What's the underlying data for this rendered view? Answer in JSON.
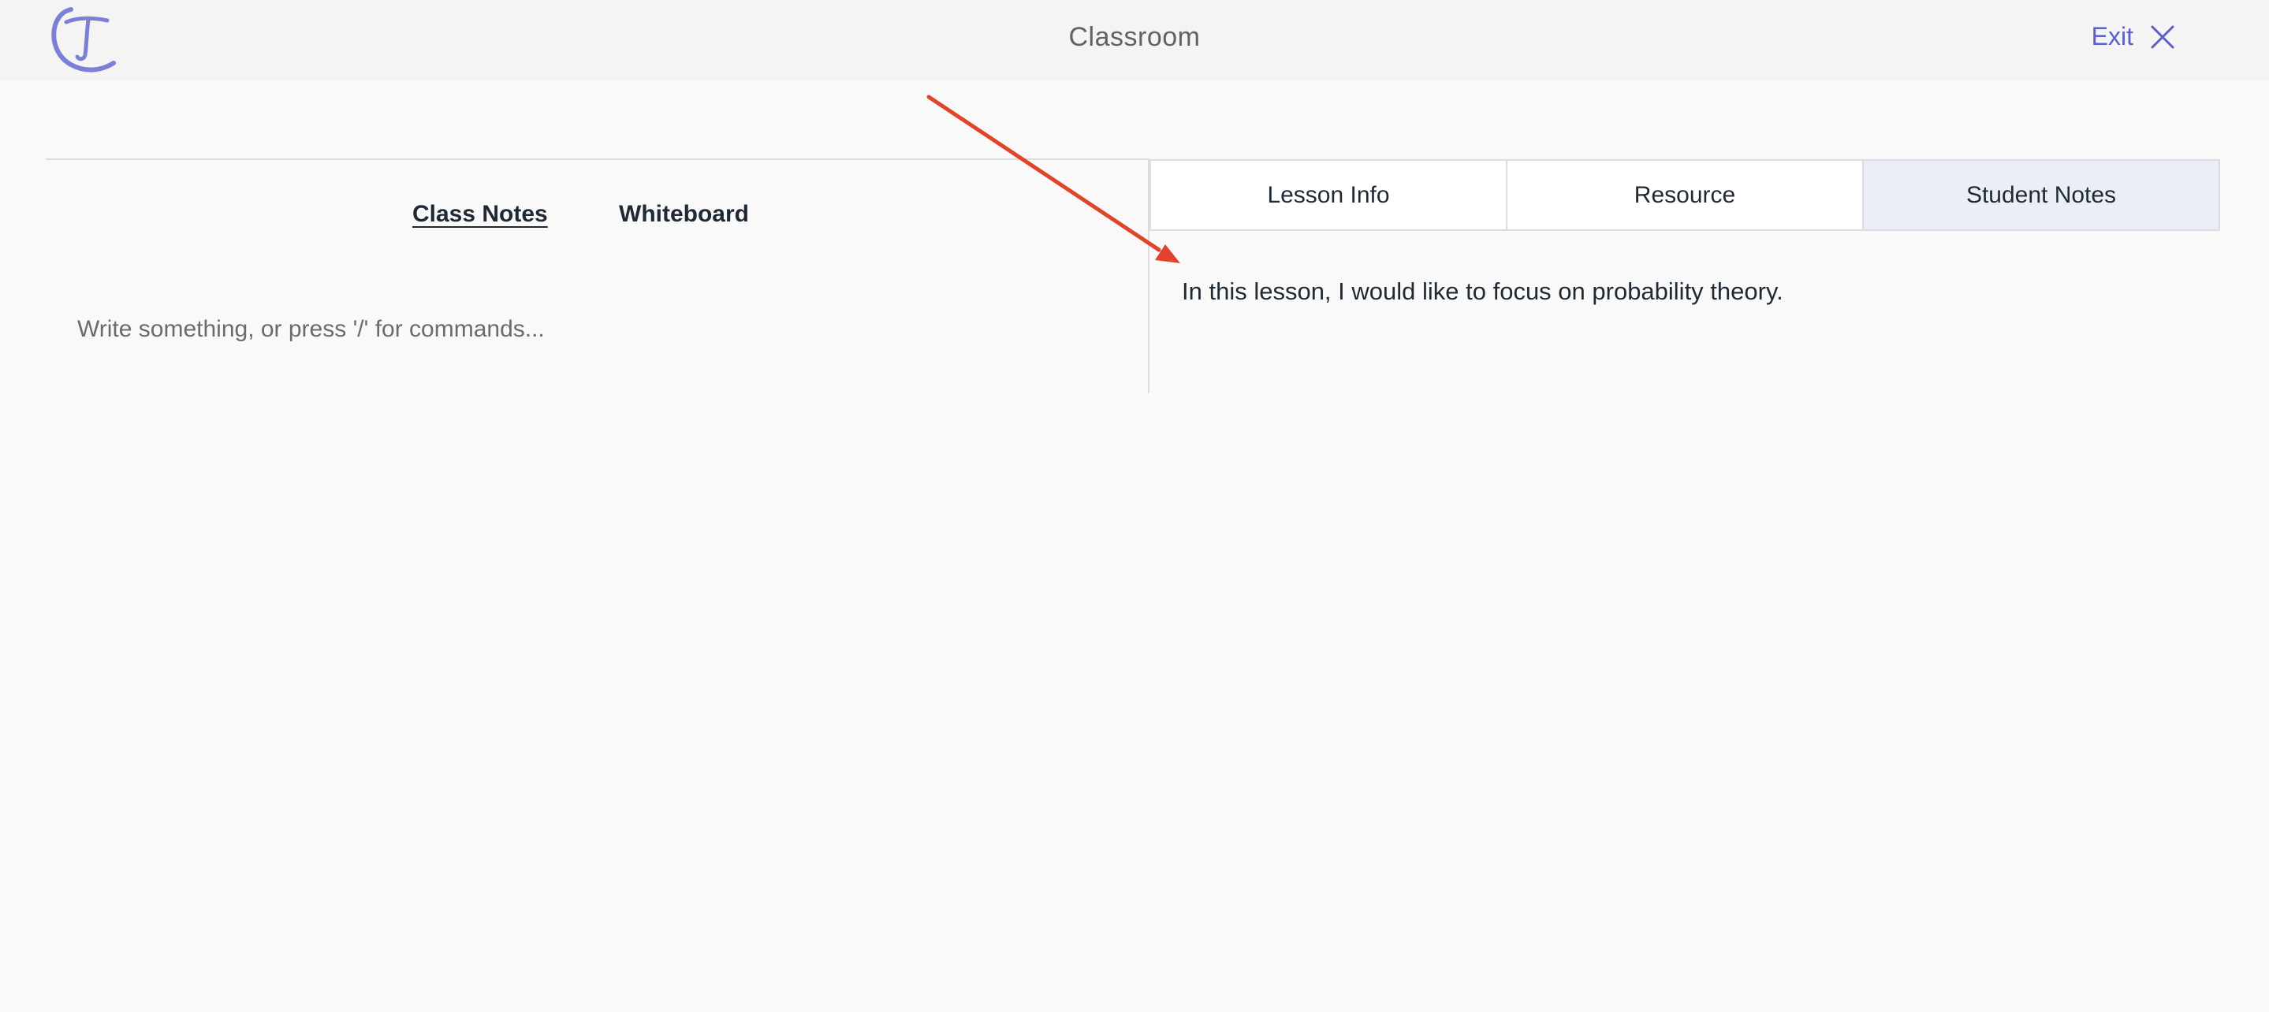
{
  "header": {
    "title": "Classroom",
    "exit_label": "Exit",
    "logo_letter": "T",
    "logo_color": "#7b7fd6",
    "accent_color": "#5b5fc7"
  },
  "left_panel": {
    "tabs": [
      {
        "label": "Class Notes",
        "active": true
      },
      {
        "label": "Whiteboard",
        "active": false
      }
    ],
    "editor_placeholder": "Write something, or press '/' for commands..."
  },
  "right_panel": {
    "tabs": [
      {
        "label": "Lesson Info",
        "active": false
      },
      {
        "label": "Resource",
        "active": false
      },
      {
        "label": "Student Notes",
        "active": true
      }
    ],
    "note_text": "In this lesson, I would like to focus on probability theory."
  },
  "annotation": {
    "arrow_color": "#e0442a"
  }
}
